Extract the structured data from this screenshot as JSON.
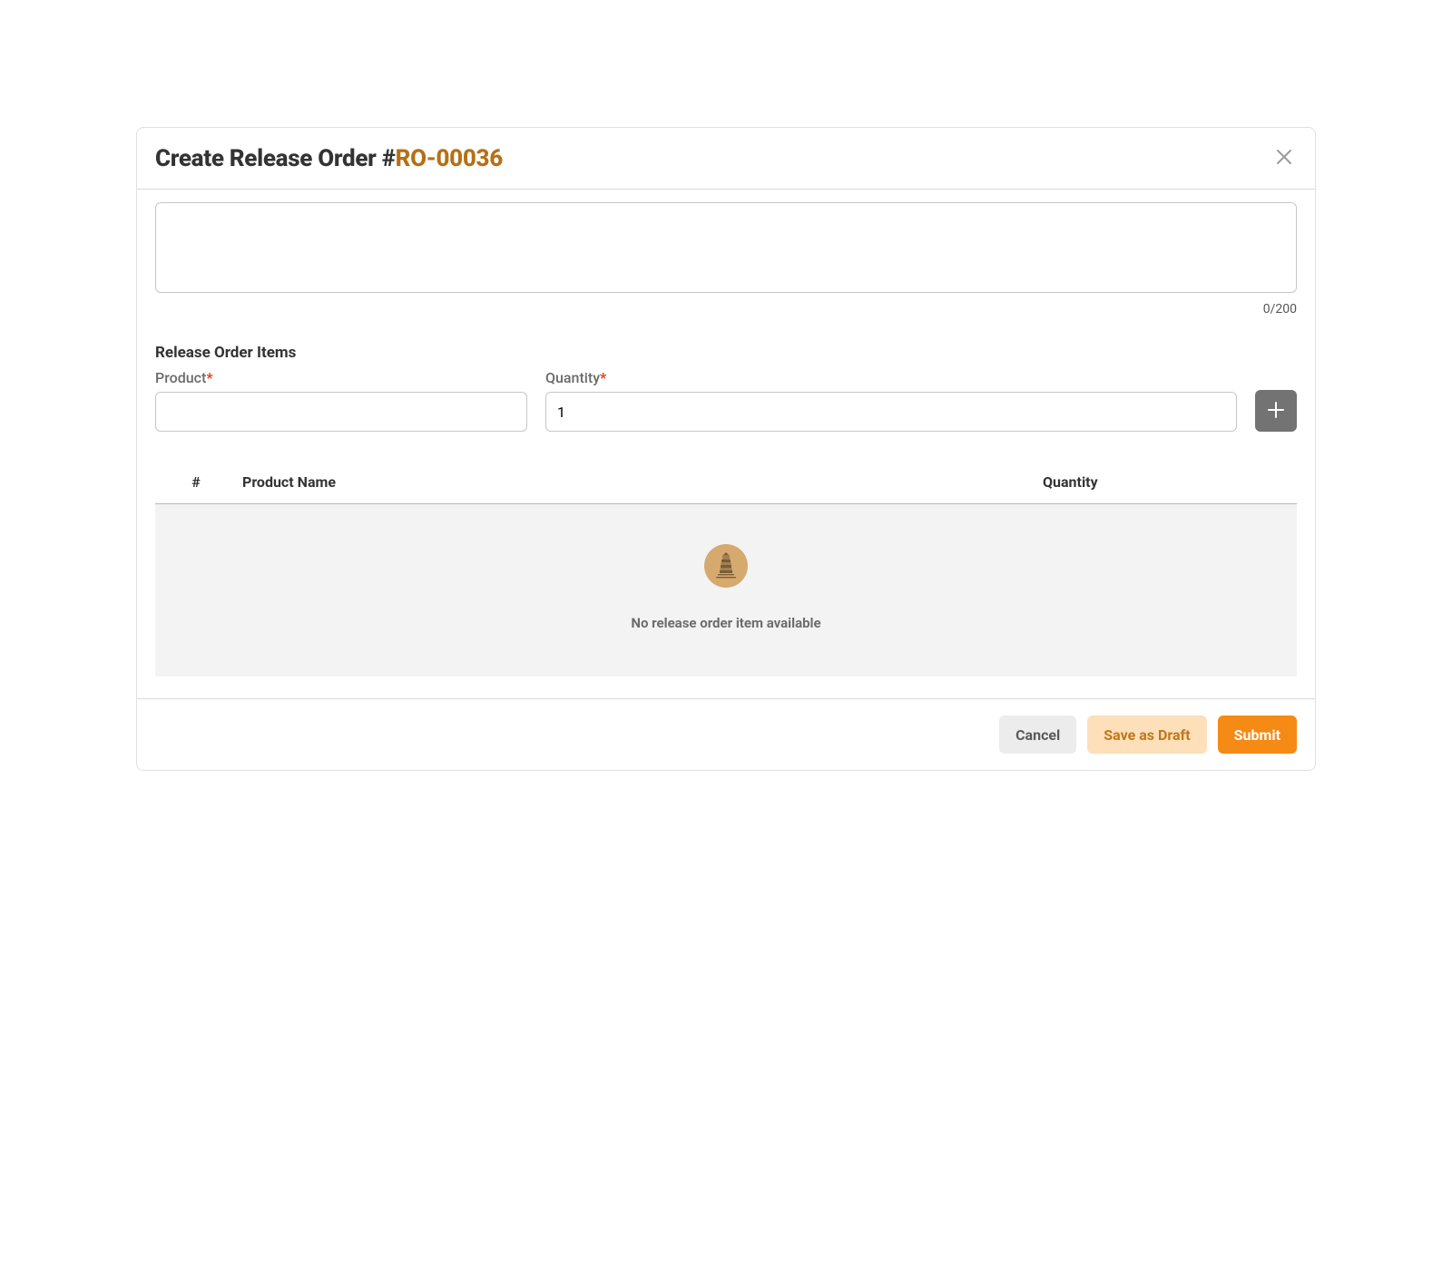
{
  "header": {
    "title_prefix": "Create Release Order #",
    "order_number": "RO-00036"
  },
  "form": {
    "description_value": "",
    "counter": "0/200",
    "items_section_title": "Release Order Items",
    "product_label": "Product",
    "quantity_label": "Quantity",
    "product_value": "",
    "quantity_value": "1"
  },
  "table": {
    "col_num": "#",
    "col_name": "Product Name",
    "col_qty": "Quantity",
    "empty_message": "No release order item available"
  },
  "footer": {
    "cancel": "Cancel",
    "draft": "Save as Draft",
    "submit": "Submit"
  }
}
